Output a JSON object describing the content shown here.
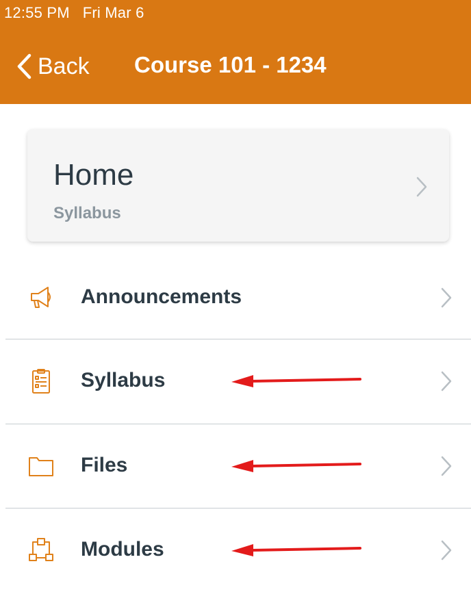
{
  "status_bar": {
    "time": "12:55 PM",
    "date": "Fri Mar 6"
  },
  "nav": {
    "back_label": "Back",
    "title": "Course 101 - 1234"
  },
  "home_card": {
    "title": "Home",
    "subtitle": "Syllabus"
  },
  "menu": [
    {
      "label": "Announcements",
      "icon": "megaphone-icon",
      "annotated": false
    },
    {
      "label": "Syllabus",
      "icon": "clipboard-icon",
      "annotated": true
    },
    {
      "label": "Files",
      "icon": "folder-icon",
      "annotated": true
    },
    {
      "label": "Modules",
      "icon": "modules-icon",
      "annotated": true
    }
  ],
  "colors": {
    "header": "#d97813",
    "icon_accent": "#e0811a",
    "text_dark": "#2d3b45",
    "text_muted": "#8b969e",
    "annotation_arrow": "#e31b1b"
  }
}
